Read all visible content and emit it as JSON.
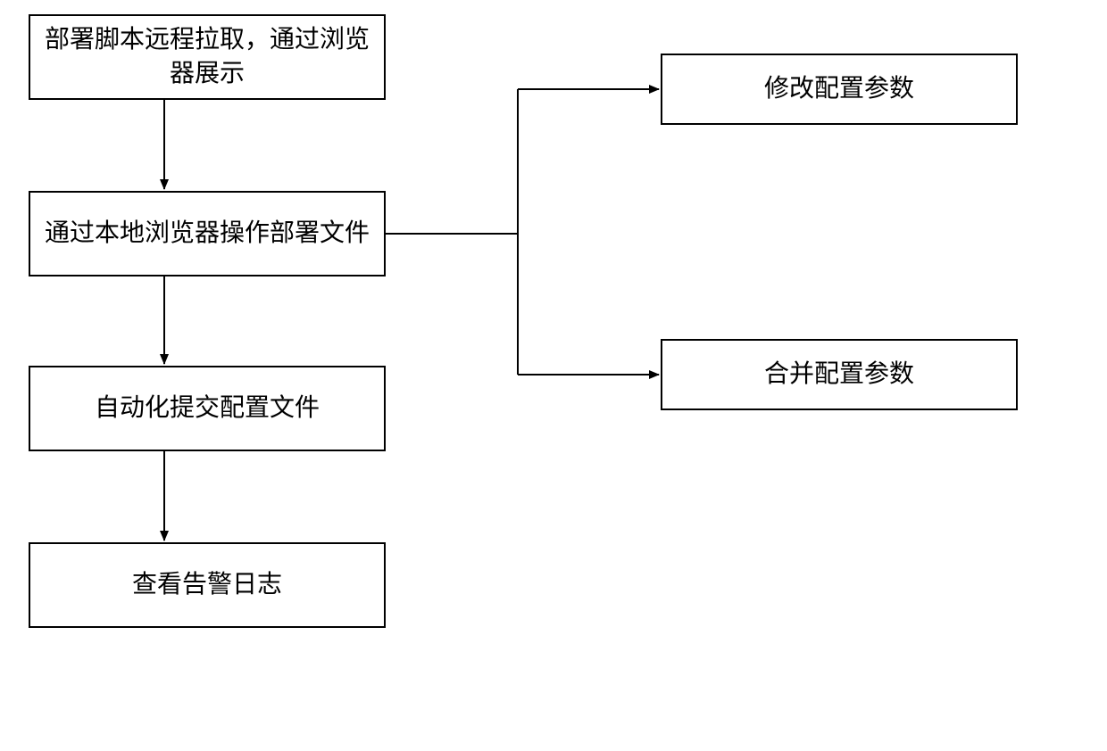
{
  "boxes": {
    "b1": "部署脚本远程拉取，通过浏览器展示",
    "b2": "通过本地浏览器操作部署文件",
    "b3": "自动化提交配置文件",
    "b4": "查看告警日志",
    "b5": "修改配置参数",
    "b6": "合并配置参数"
  }
}
